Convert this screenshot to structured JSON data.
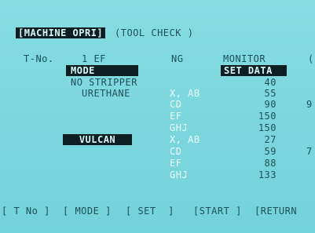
{
  "header": {
    "title": "[MACHINE OPRI]",
    "subtitle": "(TOOL CHECK )"
  },
  "top_row": {
    "tno_label": "T-No.",
    "tno_value": "1 EF",
    "ng_label": "NG",
    "monitor_label": "MONITOR",
    "monitor_partial": "("
  },
  "mode_label": "MODE",
  "set_data_label": "SET DATA",
  "rows": [
    {
      "mode": "NO STRIPPER",
      "param": "",
      "value": "40",
      "extra": ""
    },
    {
      "mode": "URETHANE",
      "param": "X, AB",
      "value": "55",
      "extra": ""
    },
    {
      "mode": "",
      "param": "CD",
      "value": "90",
      "extra": "9"
    },
    {
      "mode": "",
      "param": "EF",
      "value": "150",
      "extra": ""
    },
    {
      "mode": "",
      "param": "GHJ",
      "value": "150",
      "extra": ""
    },
    {
      "mode": "VULCAN",
      "param": "X, AB",
      "value": "27",
      "extra": ""
    },
    {
      "mode": "",
      "param": "CD",
      "value": "59",
      "extra": "7"
    },
    {
      "mode": "",
      "param": "EF",
      "value": "88",
      "extra": ""
    },
    {
      "mode": "",
      "param": "GHJ",
      "value": "133",
      "extra": ""
    }
  ],
  "softkeys": [
    {
      "label": "[ T No ]"
    },
    {
      "label": "[ MODE ]"
    },
    {
      "label": "[ SET  ]"
    },
    {
      "label": "[START ]"
    },
    {
      "label": "[RETURN"
    }
  ]
}
